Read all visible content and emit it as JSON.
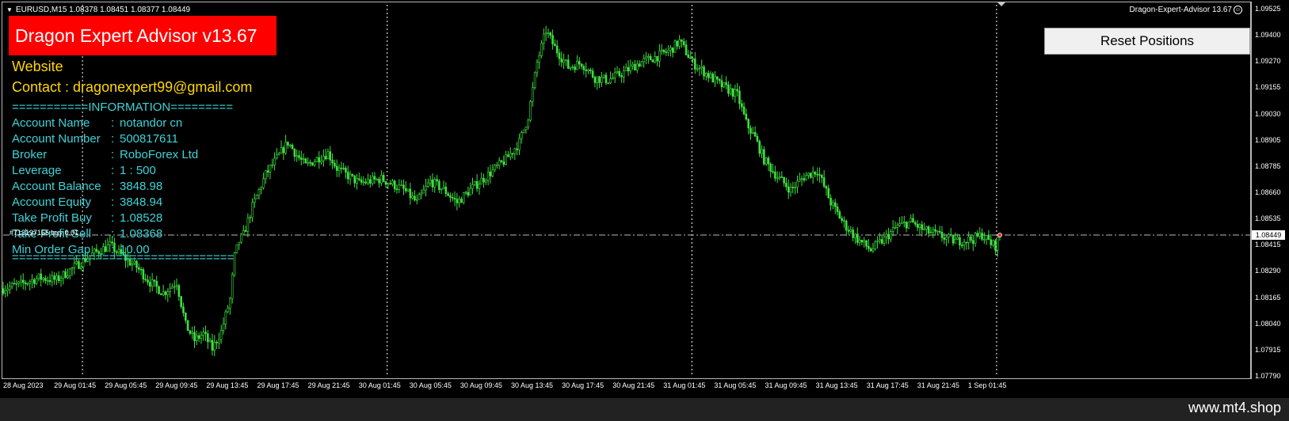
{
  "symbol": {
    "text": "EURUSD,M15  1.08378 1.08451 1.08377 1.08449"
  },
  "ea": {
    "title": "Dragon Expert Advisor v13.67",
    "top_right_label": "Dragon-Expert-Advisor 13.67",
    "reset_button": "Reset Positions",
    "website_label": "Website",
    "contact_label": "Contact : dragonexpert99@gmail.com",
    "info_header": "===========INFORMATION=========",
    "info_footer": "================================",
    "info": [
      {
        "label": "Account Name",
        "sep": ":",
        "value": "notandor cn"
      },
      {
        "label": "Account Number",
        "sep": ":",
        "value": "500817611"
      },
      {
        "label": "Broker",
        "sep": ":",
        "value": "RoboForex Ltd"
      },
      {
        "label": "Leverage",
        "sep": ":",
        "value": "1 : 500"
      },
      {
        "label": "Account Balance",
        "sep": ":",
        "value": "3848.98"
      },
      {
        "label": "Account Equity",
        "sep": ":",
        "value": "3848.94"
      },
      {
        "label": "Take Profit Buy",
        "sep": ":",
        "value": "1.08528"
      },
      {
        "label": "Take Profit Sell",
        "sep": ":",
        "value": "1.08368"
      },
      {
        "label": "Min Order Gap",
        "sep": ":",
        "value": "10.00"
      }
    ],
    "order_label": "#713197165 buy 0.01"
  },
  "price_axis": {
    "labels": [
      "1.09525",
      "1.09400",
      "1.09270",
      "1.09155",
      "1.09030",
      "1.08905",
      "1.08785",
      "1.08660",
      "1.08535",
      "1.08415",
      "1.08290",
      "1.08165",
      "1.08040",
      "1.07915",
      "1.07790"
    ],
    "current": "1.08449"
  },
  "time_axis": {
    "labels": [
      "28 Aug 2023",
      "29 Aug 01:45",
      "29 Aug 05:45",
      "29 Aug 09:45",
      "29 Aug 13:45",
      "29 Aug 17:45",
      "29 Aug 21:45",
      "30 Aug 01:45",
      "30 Aug 05:45",
      "30 Aug 09:45",
      "30 Aug 13:45",
      "30 Aug 17:45",
      "30 Aug 21:45",
      "31 Aug 01:45",
      "31 Aug 05:45",
      "31 Aug 09:45",
      "31 Aug 13:45",
      "31 Aug 17:45",
      "31 Aug 21:45",
      "1 Sep 01:45"
    ]
  },
  "chart_data": {
    "type": "candlestick",
    "symbol": "EURUSD",
    "timeframe": "M15",
    "ylim": [
      1.0779,
      1.0952
    ],
    "price_line": 1.08449,
    "colors": {
      "bull": "#3ee03e",
      "bear": "#3ee03e",
      "wick": "#3ee03e",
      "price_line": "#b8b8b8"
    },
    "path": [
      [
        0,
        1.082
      ],
      [
        8,
        1.0822
      ],
      [
        16,
        1.0825
      ],
      [
        24,
        1.0824
      ],
      [
        32,
        1.083
      ],
      [
        40,
        1.0836
      ],
      [
        48,
        1.084
      ],
      [
        56,
        1.0833
      ],
      [
        60,
        1.083
      ],
      [
        66,
        1.0823
      ],
      [
        72,
        1.0818
      ],
      [
        78,
        1.0823
      ],
      [
        82,
        1.0803
      ],
      [
        86,
        1.0796
      ],
      [
        90,
        1.0799
      ],
      [
        94,
        1.0792
      ],
      [
        98,
        1.08
      ],
      [
        102,
        1.0815
      ],
      [
        104,
        1.0835
      ],
      [
        106,
        1.0842
      ],
      [
        108,
        1.0845
      ],
      [
        112,
        1.0858
      ],
      [
        118,
        1.0873
      ],
      [
        124,
        1.0882
      ],
      [
        128,
        1.0888
      ],
      [
        132,
        1.0882
      ],
      [
        136,
        1.0877
      ],
      [
        142,
        1.0881
      ],
      [
        146,
        1.0883
      ],
      [
        150,
        1.0876
      ],
      [
        160,
        1.0869
      ],
      [
        170,
        1.0871
      ],
      [
        180,
        1.0866
      ],
      [
        186,
        1.086
      ],
      [
        192,
        1.087
      ],
      [
        198,
        1.0866
      ],
      [
        204,
        1.086
      ],
      [
        210,
        1.0866
      ],
      [
        218,
        1.0873
      ],
      [
        226,
        1.088
      ],
      [
        232,
        1.0888
      ],
      [
        236,
        1.09
      ],
      [
        240,
        1.0925
      ],
      [
        244,
        1.094
      ],
      [
        248,
        1.0932
      ],
      [
        254,
        1.0923
      ],
      [
        260,
        1.0925
      ],
      [
        266,
        1.0918
      ],
      [
        272,
        1.0917
      ],
      [
        278,
        1.092
      ],
      [
        286,
        1.0925
      ],
      [
        294,
        1.0928
      ],
      [
        300,
        1.0931
      ],
      [
        304,
        1.0935
      ],
      [
        310,
        1.0925
      ],
      [
        316,
        1.092
      ],
      [
        322,
        1.0915
      ],
      [
        330,
        1.091
      ],
      [
        334,
        1.0897
      ],
      [
        338,
        1.089
      ],
      [
        342,
        1.088
      ],
      [
        348,
        1.0872
      ],
      [
        354,
        1.0866
      ],
      [
        360,
        1.0872
      ],
      [
        366,
        1.0875
      ],
      [
        372,
        1.086
      ],
      [
        378,
        1.085
      ],
      [
        384,
        1.0843
      ],
      [
        390,
        1.0838
      ],
      [
        396,
        1.0843
      ],
      [
        402,
        1.0849
      ],
      [
        408,
        1.0851
      ],
      [
        414,
        1.0847
      ],
      [
        420,
        1.0845
      ],
      [
        428,
        1.0842
      ],
      [
        436,
        1.0843
      ],
      [
        440,
        1.0845
      ],
      [
        444,
        1.0841
      ],
      [
        446,
        1.084
      ],
      [
        448,
        1.0845
      ]
    ],
    "path_x_max": 448,
    "time_tick_count": 20,
    "vertical_grid_after_ticks": [
      1,
      7,
      13,
      19
    ]
  },
  "watermark": "www.mt4.shop"
}
